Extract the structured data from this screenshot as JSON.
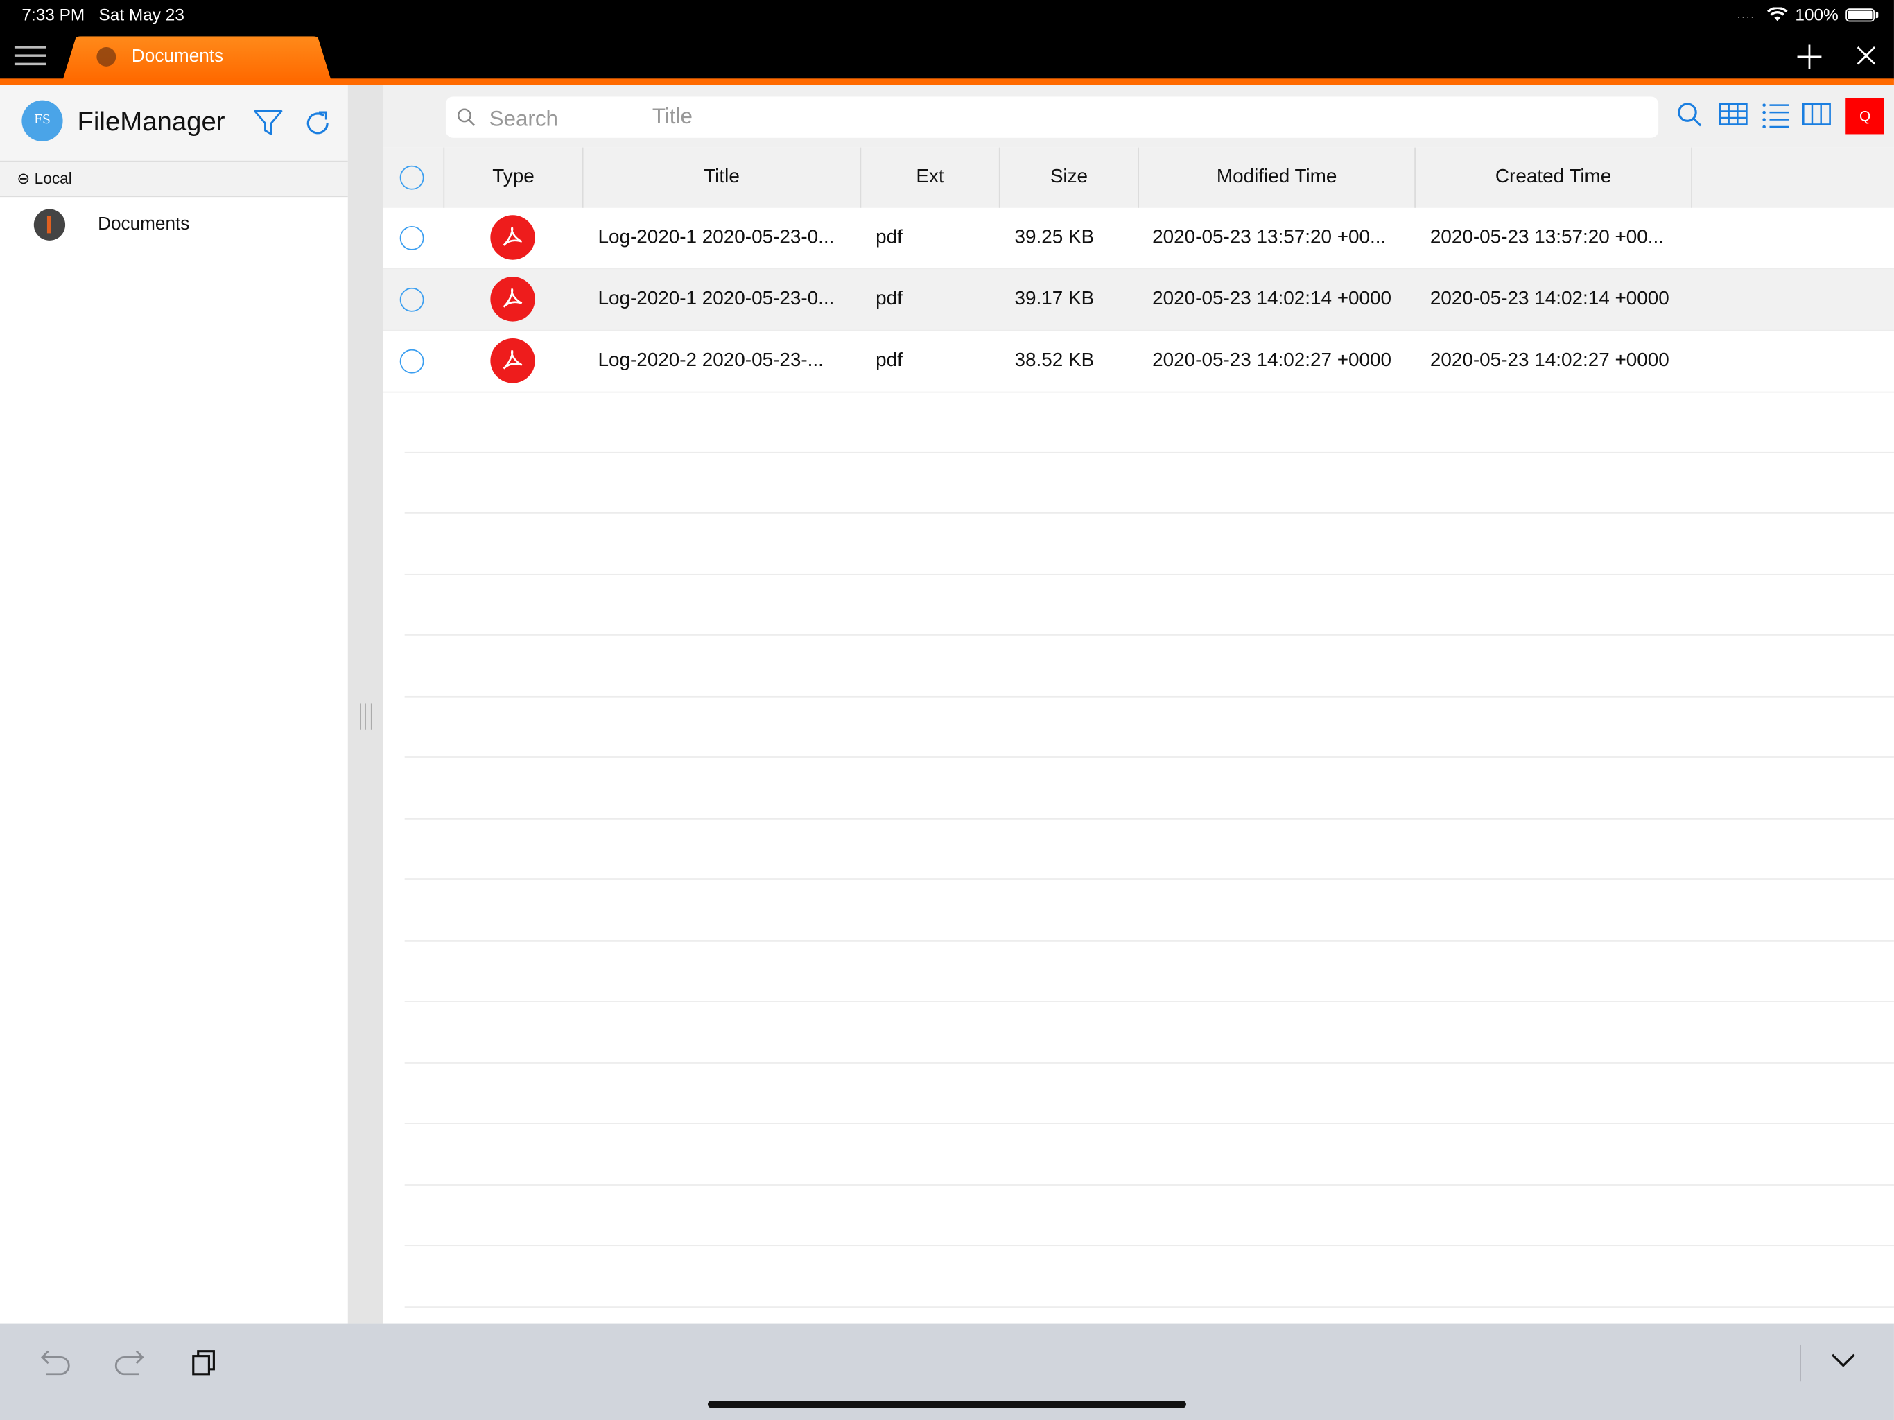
{
  "status_bar": {
    "time": "7:33 PM",
    "date": "Sat May 23",
    "signal_dots": "....",
    "battery": "100%"
  },
  "tab": {
    "label": "Documents"
  },
  "sidebar": {
    "logo_text": "FS",
    "app_title": "FileManager",
    "section": "⊖ Local",
    "items": [
      {
        "label": "Documents"
      }
    ]
  },
  "search": {
    "placeholder": "Search",
    "scope": "Title"
  },
  "toolbar": {
    "red_button": "Q"
  },
  "table": {
    "columns": [
      "Type",
      "Title",
      "Ext",
      "Size",
      "Modified Time",
      "Created Time"
    ],
    "rows": [
      {
        "type": "pdf-icon",
        "title": "Log-2020-1 2020-05-23-0...",
        "ext": "pdf",
        "size": "39.25 KB",
        "modified": "2020-05-23 13:57:20 +00...",
        "created": "2020-05-23 13:57:20 +00..."
      },
      {
        "type": "pdf-icon",
        "title": "Log-2020-1 2020-05-23-0...",
        "ext": "pdf",
        "size": "39.17 KB",
        "modified": "2020-05-23 14:02:14 +0000",
        "created": "2020-05-23 14:02:14 +0000"
      },
      {
        "type": "pdf-icon",
        "title": "Log-2020-2 2020-05-23-...",
        "ext": "pdf",
        "size": "38.52 KB",
        "modified": "2020-05-23 14:02:27 +0000",
        "created": "2020-05-23 14:02:27 +0000"
      }
    ]
  },
  "colors": {
    "accent": "#ff6a00",
    "link": "#1a7ee0",
    "pdf": "#ee1c1c"
  }
}
